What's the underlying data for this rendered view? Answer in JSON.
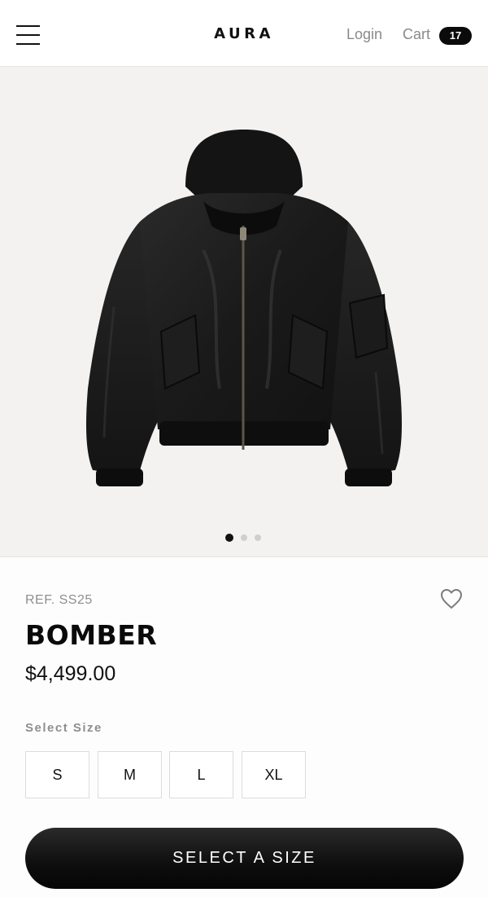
{
  "header": {
    "brand": "AURA",
    "login_label": "Login",
    "cart_label": "Cart",
    "cart_count": "17"
  },
  "gallery": {
    "image_icon": "black-hooded-bomber-jacket",
    "slide_count": 3,
    "active_slide": 1
  },
  "product": {
    "reference": "REF. SS25",
    "name": "BOMBER",
    "price": "$4,499.00"
  },
  "size_selector": {
    "label": "Select Size",
    "options": [
      "S",
      "M",
      "L",
      "XL"
    ]
  },
  "cta": {
    "label": "SELECT A SIZE"
  },
  "colors": {
    "accent": "#0b0b0b",
    "muted_text": "#8f8f8f",
    "image_background": "#f3f2f0"
  }
}
